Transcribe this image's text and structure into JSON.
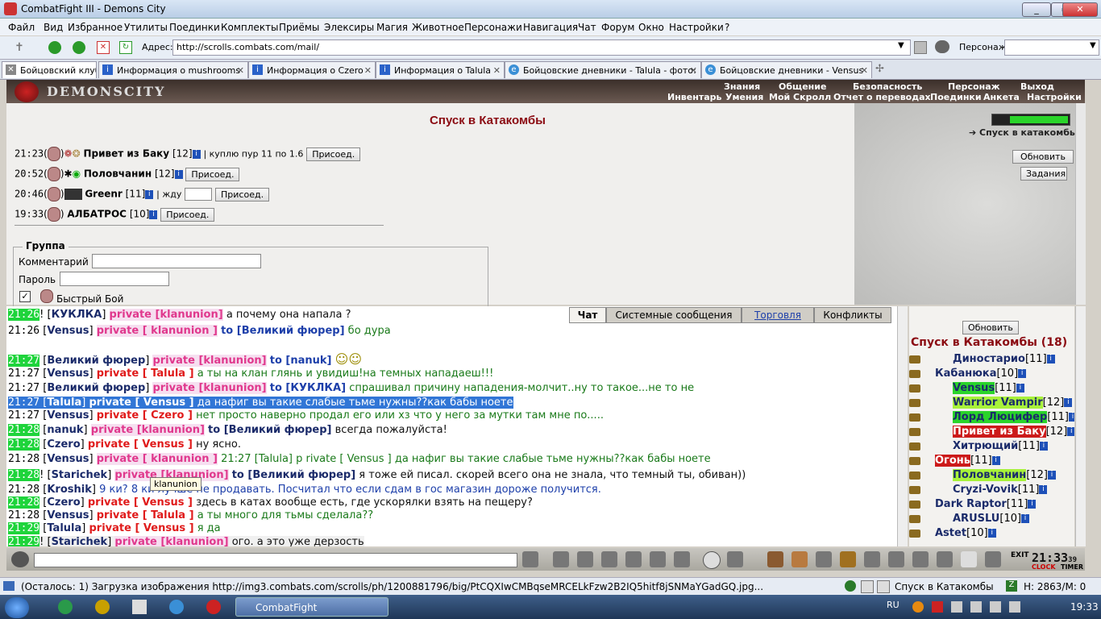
{
  "window": {
    "title": "CombatFight III - Demons City"
  },
  "menu": [
    "Файл",
    "Вид",
    "Избранное",
    "Утилиты",
    "Поединки",
    "Комплекты",
    "Приёмы",
    "Элексиры",
    "Магия",
    "Животное",
    "Персонажи",
    "Навигация",
    "Чат",
    "Форум",
    "Окно",
    "Настройки",
    "?"
  ],
  "address": {
    "label": "Адрес:",
    "value": "http://scrolls.combats.com/mail/",
    "persona_label": "Персонаж:"
  },
  "tabs": [
    {
      "label": "Бойцовский клуб"
    },
    {
      "label": "Информация о mushrooms"
    },
    {
      "label": "Информация о Czero"
    },
    {
      "label": "Информация о Talula"
    },
    {
      "label": "Бойцовские дневники - Talula - фото:"
    },
    {
      "label": "Бойцовские дневники - Vensus"
    }
  ],
  "game_nav": {
    "logo": "DEMONSCITY",
    "top": [
      "Знания",
      "Общение",
      "Безопасность",
      "Персонаж",
      "Выход"
    ],
    "sub": [
      "Инвентарь",
      "Умения",
      "Мой Скролл",
      "Отчет о переводах",
      "Поединки",
      "Анкета",
      "Настройки"
    ]
  },
  "room": {
    "title": "Спуск в Катакомбы",
    "link": "Спуск в катакомбы",
    "refresh": "Обновить",
    "tasks": "Задания"
  },
  "requests": [
    {
      "time": "21:23",
      "name": "Привет из Баку",
      "level": "[12]",
      "note": "| куплю пур 11 по 1.6",
      "join": "Присоед."
    },
    {
      "time": "20:52",
      "name": "Половчанин",
      "level": "[12]",
      "note": "",
      "join": "Присоед."
    },
    {
      "time": "20:46",
      "name": "Greenr",
      "level": "[11]",
      "note": "| жду",
      "join": "Присоед."
    },
    {
      "time": "19:33",
      "name": "АЛБАТРОС",
      "level": "[10]",
      "note": "",
      "join": "Присоед."
    }
  ],
  "group": {
    "legend": "Группа",
    "comment_label": "Комментарий",
    "password_label": "Пароль",
    "fast_fight": "Быстрый Бой"
  },
  "chat_tabs": [
    "Чат",
    "Системные сообщения",
    "Торговля",
    "Конфликты"
  ],
  "chat": [
    {
      "time": "21:26",
      "g": true,
      "prefix": "! ",
      "from": "КУКЛКА",
      "priv": "private [klanunion]",
      "to": "",
      "text": "а почему она напала ?"
    },
    {
      "time": "21:26",
      "g": false,
      "prefix": "",
      "from": "Vensus",
      "priv": "private [ klanunion ]",
      "to": "to [Великий фюрер]",
      "text": "бо дура"
    },
    {
      "time": "21:27",
      "g": true,
      "prefix": "",
      "from": "Великий фюрер",
      "priv": "private [klanunion]",
      "to": "to [nanuk]",
      "text": ""
    },
    {
      "time": "21:27",
      "g": false,
      "prefix": "",
      "from": "Vensus",
      "priv": "private [ Talula ]",
      "to": "",
      "text": "а ты на клан глянь и увидиш!на темных нападаеш!!!"
    },
    {
      "time": "21:27",
      "g": false,
      "prefix": "",
      "from": "Великий фюрер",
      "priv": "private [klanunion]",
      "to": "to [КУКЛКА]",
      "text": "спрашивал причину нападения-молчит..ну то такое...не то не"
    },
    {
      "time": "21:27",
      "g": false,
      "prefix": "",
      "from": "Talula",
      "priv": "private [ Vensus ]",
      "to": "",
      "text": "да нафиг вы такие слабые тьме нужны??как бабы ноете",
      "hl": true
    },
    {
      "time": "21:27",
      "g": false,
      "prefix": "",
      "from": "Vensus",
      "priv": "private [ Czero ]",
      "to": "",
      "text": "нет просто наверно продал его или хз что у него за мутки там мне по....."
    },
    {
      "time": "21:28",
      "g": true,
      "prefix": "",
      "from": "nanuk",
      "priv": "private [klanunion]",
      "to": "to [Великий фюрер]",
      "text": "всегда пожалуйста!"
    },
    {
      "time": "21:28",
      "g": true,
      "prefix": "",
      "from": "Czero",
      "priv": "private [ Vensus ]",
      "to": "",
      "text": "ну ясно."
    },
    {
      "time": "21:28",
      "g": false,
      "prefix": "",
      "from": "Vensus",
      "priv": "private [ klanunion ]",
      "to": "21:27 [Talula] p rivate [ Vensus ]",
      "text": "да нафиг вы такие слабые тьме нужны??как бабы ноете"
    },
    {
      "time": "21:28",
      "g": true,
      "prefix": "! ",
      "from": "Starichek",
      "priv": "private [klanunion]",
      "to": "to [Великий фюрер]",
      "text": "я тоже ей писал. скорей всего она не знала, что темный ты, обиван))"
    },
    {
      "time": "21:28",
      "g": false,
      "prefix": "",
      "from": "Kroshik",
      "priv": "",
      "to": "",
      "text": "9 ки? 8 ки лучше не продавать. Посчитал что если сдам в гос магазин дороже получится."
    },
    {
      "time": "21:28",
      "g": true,
      "prefix": "",
      "from": "Czero",
      "priv": "private [ Vensus ]",
      "to": "",
      "text": "здесь в катах вообще есть, где ускорялки взять на пещеру?"
    },
    {
      "time": "21:28",
      "g": false,
      "prefix": "",
      "from": "Vensus",
      "priv": "private [ Talula ]",
      "to": "",
      "text": "а ты много для тьмы сделала??"
    },
    {
      "time": "21:29",
      "g": true,
      "prefix": "",
      "from": "Talula",
      "priv": "private [ Vensus ]",
      "to": "",
      "text": "я да"
    },
    {
      "time": "21:29",
      "g": true,
      "prefix": "! ",
      "from": "Starichek",
      "priv": "private [klanunion]",
      "to": "",
      "text": "ого. а это уже дерзость"
    }
  ],
  "tooltip": "klanunion",
  "online": {
    "refresh": "Обновить",
    "title": "Спуск в Катакомбы (18)",
    "players": [
      {
        "name": "Диностарио",
        "level": "[11]",
        "bg": ""
      },
      {
        "name": "Кабанюка",
        "level": "[10]",
        "bg": ""
      },
      {
        "name": "Vensus",
        "level": "[11]",
        "bg": "#2ad42a"
      },
      {
        "name": "Warrior Vampir",
        "level": "[12]",
        "bg": "#a8f23a"
      },
      {
        "name": "Лорд Люцифер",
        "level": "[11]",
        "bg": "#2ad42a"
      },
      {
        "name": "Привет из Баку",
        "level": "[12]",
        "bg": "#cc1a1a"
      },
      {
        "name": "Хитрющий",
        "level": "[11]",
        "bg": ""
      },
      {
        "name": "Огонь",
        "level": "[11]",
        "bg": "#cc1a1a"
      },
      {
        "name": "Половчанин",
        "level": "[12]",
        "bg": "#a8f23a"
      },
      {
        "name": "Cryzi-Vovik",
        "level": "[11]",
        "bg": ""
      },
      {
        "name": "Dark Raptor",
        "level": "[11]",
        "bg": ""
      },
      {
        "name": "ARUSLU",
        "level": "[10]",
        "bg": ""
      },
      {
        "name": "Astet",
        "level": "[10]",
        "bg": ""
      }
    ]
  },
  "clock": {
    "time": "21:33",
    "seconds": "39",
    "clock_label": "CLOCK",
    "timer_label": "TIMER"
  },
  "status": {
    "text": "(Осталось: 1) Загрузка изображения http://img3.combats.com/scrolls/ph/1200881796/big/PtCQXIwCMBqseMRCELkFzw2B2IQ5hitf8jSNMaYGadGQ.jpg...",
    "location": "Спуск в Катакомбы",
    "hp": "Н: 2863/М: 0"
  },
  "taskbar": {
    "app": "CombatFight",
    "lang": "RU",
    "time": "19:33"
  },
  "colors": {
    "accent": "#8b0b12",
    "private": "#e0388d",
    "name": "#1b2b6a",
    "highlight": "#3176d6"
  }
}
